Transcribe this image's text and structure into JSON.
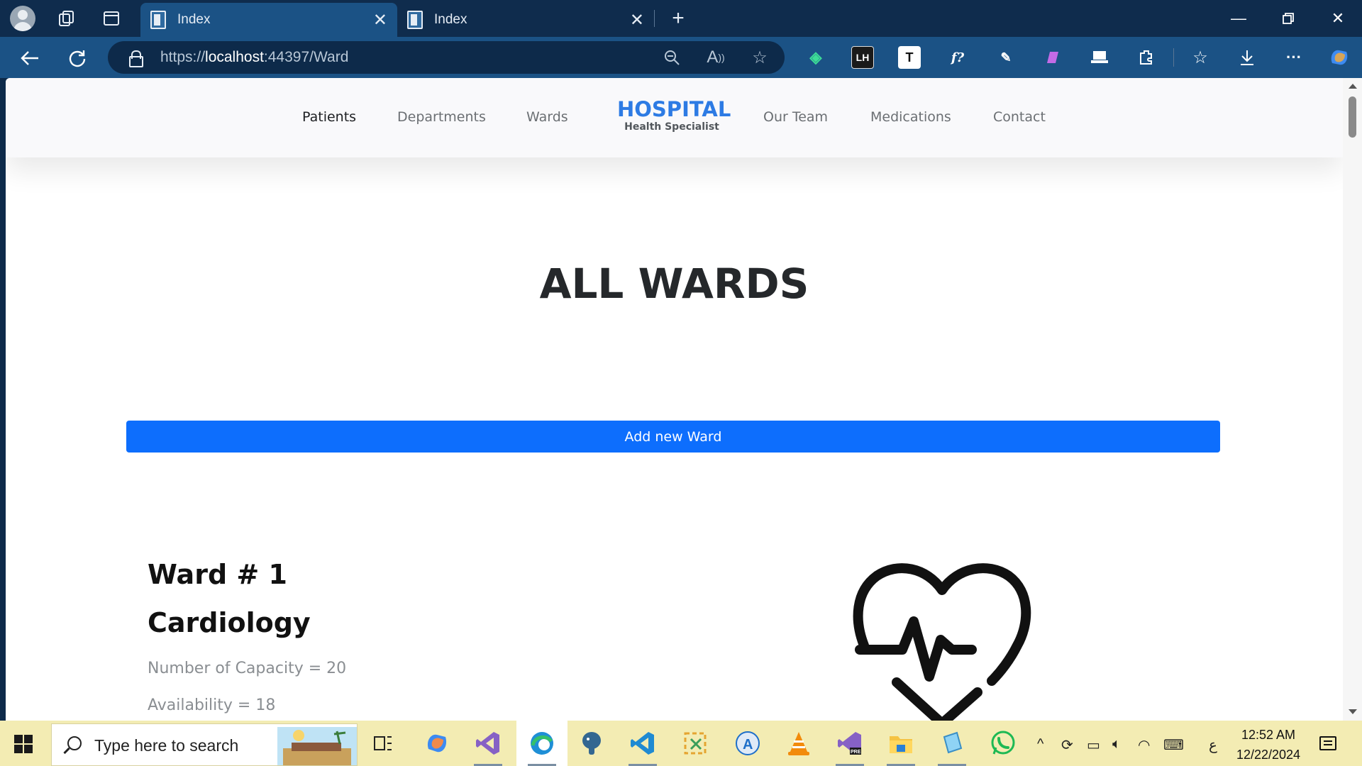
{
  "browser": {
    "tabs": [
      {
        "title": "Index",
        "active": true
      },
      {
        "title": "Index",
        "active": false
      }
    ],
    "new_tab_label": "+",
    "url": {
      "scheme": "https://",
      "host": "localhost",
      "rest": ":44397/Ward"
    },
    "extensions": [
      "puzzle-extension-icon",
      "lh-extension",
      "t-extension",
      "f-extension",
      "eyedropper-extension",
      "purple-extension",
      "laptop-extension"
    ],
    "ext_labels": {
      "lh": "LH",
      "t": "T",
      "f": "f?"
    }
  },
  "site": {
    "nav": {
      "patients": "Patients",
      "departments": "Departments",
      "wards": "Wards",
      "our_team": "Our Team",
      "medications": "Medications",
      "contact": "Contact"
    },
    "brand": {
      "title": "HOSPITAL",
      "subtitle": "Health Specialist"
    },
    "active_nav": "Patients"
  },
  "main": {
    "heading": "ALL WARDS",
    "add_button": "Add new Ward",
    "wards": [
      {
        "number": "Ward # 1",
        "department": "Cardiology",
        "capacity": "Number of Capacity = 20",
        "availability": "Availability = 18",
        "icon": "heartbeat-icon"
      }
    ]
  },
  "taskbar": {
    "search_placeholder": "Type here to search",
    "time": "12:52 AM",
    "date": "12/22/2024",
    "language": "ع",
    "colors": {
      "accent": "#0d6efd",
      "brand": "#2d7be4",
      "taskbar": "#f3ecb3"
    }
  }
}
